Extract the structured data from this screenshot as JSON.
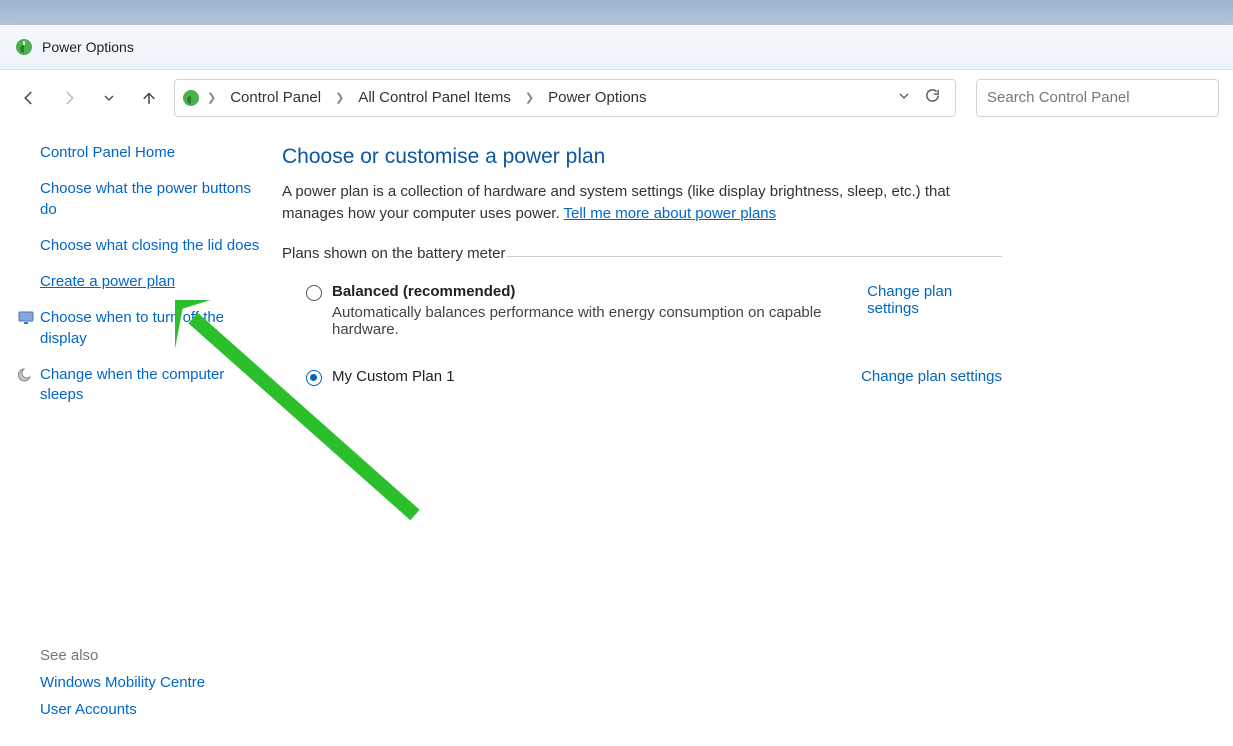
{
  "window": {
    "title": "Power Options"
  },
  "nav": {
    "breadcrumbs": [
      "Control Panel",
      "All Control Panel Items",
      "Power Options"
    ],
    "search_placeholder": "Search Control Panel"
  },
  "sidebar": {
    "home": "Control Panel Home",
    "items": [
      {
        "label": "Choose what the power buttons do",
        "icon": "",
        "active": false
      },
      {
        "label": "Choose what closing the lid does",
        "icon": "",
        "active": false
      },
      {
        "label": "Create a power plan",
        "icon": "",
        "active": true
      },
      {
        "label": "Choose when to turn off the display",
        "icon": "display",
        "active": false
      },
      {
        "label": "Change when the computer sleeps",
        "icon": "sleep",
        "active": false
      }
    ],
    "seealso_label": "See also",
    "seealso": [
      "Windows Mobility Centre",
      "User Accounts"
    ]
  },
  "content": {
    "heading": "Choose or customise a power plan",
    "description": "A power plan is a collection of hardware and system settings (like display brightness, sleep, etc.) that manages how your computer uses power. ",
    "learn_more": "Tell me more about power plans",
    "section_label": "Plans shown on the battery meter",
    "plans": [
      {
        "name": "Balanced (recommended)",
        "sub": "Automatically balances performance with energy consumption on capable hardware.",
        "checked": false,
        "link": "Change plan settings"
      },
      {
        "name": "My Custom Plan 1",
        "sub": "",
        "checked": true,
        "link": "Change plan settings"
      }
    ]
  }
}
